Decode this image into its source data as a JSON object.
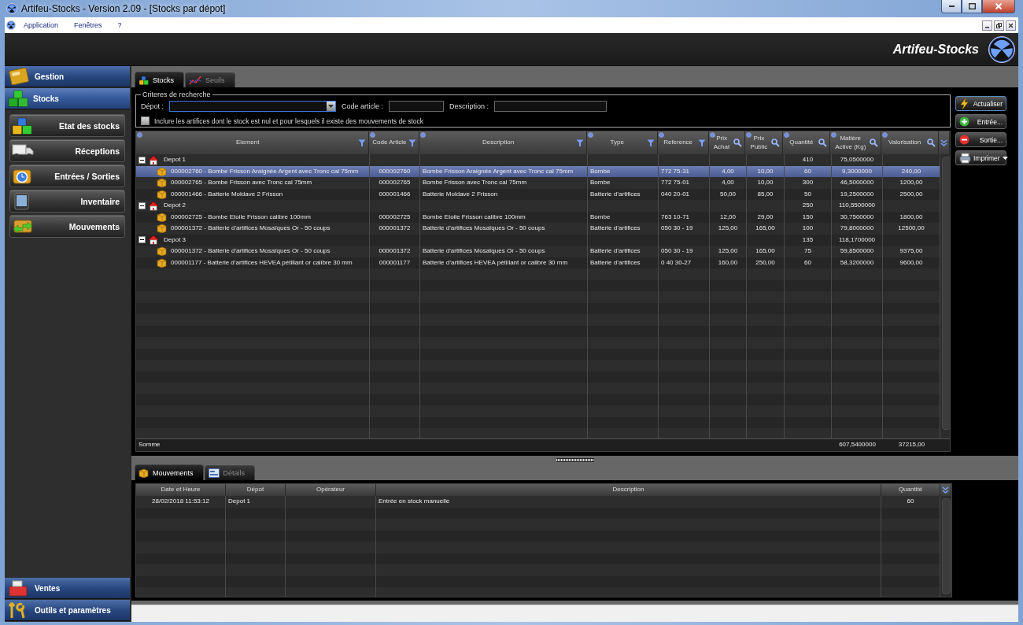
{
  "window": {
    "title": "Artifeu-Stocks - Version 2.09 - [Stocks par dépot]"
  },
  "menu": [
    "Application",
    "Fenêtres",
    "?"
  ],
  "header": {
    "brand": "Artifeu-Stocks"
  },
  "sidebar": {
    "sections": [
      {
        "label": "Gestion",
        "selected": false
      },
      {
        "label": "Stocks",
        "selected": true
      }
    ],
    "items": [
      "Etat des stocks",
      "Réceptions",
      "Entrées / Sorties",
      "Inventaire",
      "Mouvements"
    ],
    "bottom_sections": [
      {
        "label": "Ventes",
        "selected": false
      },
      {
        "label": "Outils et paramètres",
        "selected": false
      }
    ]
  },
  "tabs": [
    {
      "label": "Stocks",
      "selected": true
    },
    {
      "label": "Seuils",
      "selected": false
    }
  ],
  "criteria": {
    "title": "Criteres de recherche",
    "fields": [
      {
        "label": "Dépot :",
        "kind": "dropdown"
      },
      {
        "label": "Code article :",
        "kind": "text"
      },
      {
        "label": "Description :",
        "kind": "text"
      }
    ],
    "option": {
      "label": "Inclure les artifices dont le stock est nul et pour lesquels il existe des mouvements de stock",
      "checked": false
    }
  },
  "actions": [
    {
      "label": "Actualiser",
      "dropdown": false
    },
    {
      "label": "Entrée...",
      "dropdown": false
    },
    {
      "label": "Sortie...",
      "dropdown": false
    },
    {
      "label": "Imprimer",
      "dropdown": true
    }
  ],
  "table": {
    "columns": [
      {
        "label": "Element",
        "kind": "text"
      },
      {
        "label": "Code Article",
        "kind": "text"
      },
      {
        "label": "Description",
        "kind": "text"
      },
      {
        "label": "Type",
        "kind": "text"
      },
      {
        "label": "Reference",
        "kind": "text"
      },
      {
        "label": "Prix Achat",
        "kind": "numeric"
      },
      {
        "label": "Prix Public",
        "kind": "numeric"
      },
      {
        "label": "Quantité",
        "kind": "numeric"
      },
      {
        "label": "Matière Active (Kg)",
        "kind": "numeric"
      },
      {
        "label": "Valorisation",
        "kind": "numeric"
      }
    ],
    "rows": [
      {
        "label": "Depot 1",
        "expanded": true,
        "selected": false,
        "quantite": "410",
        "matiere_active": "75,0500000",
        "children": [
          {
            "element": "000002760 - Bombe Frisson Araignée Argent avec Tronc cal 75mm",
            "code_article": "000002760",
            "description": "Bombe Frisson Araignée Argent avec Tronc cal 75mm",
            "type": "Bombe",
            "reference": "772 75-31",
            "prix_achat": "4,00",
            "prix_public": "10,00",
            "quantite": "60",
            "matiere_active": "9,3000000",
            "valorisation": "240,00",
            "selected": true
          },
          {
            "element": "000002765 - Bombe Frisson avec Tronc cal 75mm",
            "code_article": "000002765",
            "description": "Bombe Frisson avec Tronc cal 75mm",
            "type": "Bombe",
            "reference": "772 75-01",
            "prix_achat": "4,00",
            "prix_public": "10,00",
            "quantite": "300",
            "matiere_active": "46,5000000",
            "valorisation": "1200,00",
            "selected": false
          },
          {
            "element": "000001466 - Batterie Moldave 2 Frisson",
            "code_article": "000001466",
            "description": "Batterie Moldave 2 Frisson",
            "type": "Batterie d’artifices",
            "reference": "040 20-01",
            "prix_achat": "50,00",
            "prix_public": "85,00",
            "quantite": "50",
            "matiere_active": "19,2500000",
            "valorisation": "2500,00",
            "selected": false
          }
        ]
      },
      {
        "label": "Depot 2",
        "expanded": true,
        "selected": false,
        "quantite": "250",
        "matiere_active": "110,5500000",
        "children": [
          {
            "element": "000002725 - Bombe Etoile Frisson calibre 100mm",
            "code_article": "000002725",
            "description": "Bombe Etoile Frisson calibre 100mm",
            "type": "Bombe",
            "reference": "763 10-71",
            "prix_achat": "12,00",
            "prix_public": "29,00",
            "quantite": "150",
            "matiere_active": "30,7500000",
            "valorisation": "1800,00",
            "selected": false
          },
          {
            "element": "000001372 - Batterie d'artifices Mosaïques Or - 50 coups",
            "code_article": "000001372",
            "description": "Batterie d'artifices Mosaïques Or - 50 coups",
            "type": "Batterie d’artifices",
            "reference": "050 30 - 19",
            "prix_achat": "125,00",
            "prix_public": "165,00",
            "quantite": "100",
            "matiere_active": "79,8000000",
            "valorisation": "12500,00",
            "selected": false
          }
        ]
      },
      {
        "label": "Depot 3",
        "expanded": true,
        "selected": false,
        "quantite": "135",
        "matiere_active": "118,1700000",
        "children": [
          {
            "element": "000001372 - Batterie d'artifices Mosaïques Or - 50 coups",
            "code_article": "000001372",
            "description": "Batterie d'artifices Mosaïques Or - 50 coups",
            "type": "Batterie d’artifices",
            "reference": "050 30 - 19",
            "prix_achat": "125,00",
            "prix_public": "165,00",
            "quantite": "75",
            "matiere_active": "59,8500000",
            "valorisation": "9375,00",
            "selected": false
          },
          {
            "element": "000001177 - Batterie d’artifices HEVEA pétillant or calibre 30 mm",
            "code_article": "000001177",
            "description": "Batterie d’artifices HEVEA pétillant or calibre 30 mm",
            "type": "Batterie d’artifices",
            "reference": "0 40 30-27",
            "prix_achat": "160,00",
            "prix_public": "250,00",
            "quantite": "60",
            "matiere_active": "58,3200000",
            "valorisation": "9600,00",
            "selected": false
          }
        ]
      }
    ],
    "footer": {
      "label": "Somme",
      "matiere_active": "607,5400000",
      "valorisation": "37215,00"
    }
  },
  "movements": {
    "tabs": [
      {
        "label": "Mouvements",
        "selected": true
      },
      {
        "label": "Détails",
        "selected": false
      }
    ],
    "columns": [
      "Date et Heure",
      "Dépot",
      "Opérateur",
      "Description",
      "Quantité"
    ],
    "rows": [
      {
        "date": "28/02/2018 11:53:12",
        "depot": "Depot 1",
        "description": "Entrée en stock manuelle",
        "quantite": "60",
        "selected": false
      }
    ]
  }
}
